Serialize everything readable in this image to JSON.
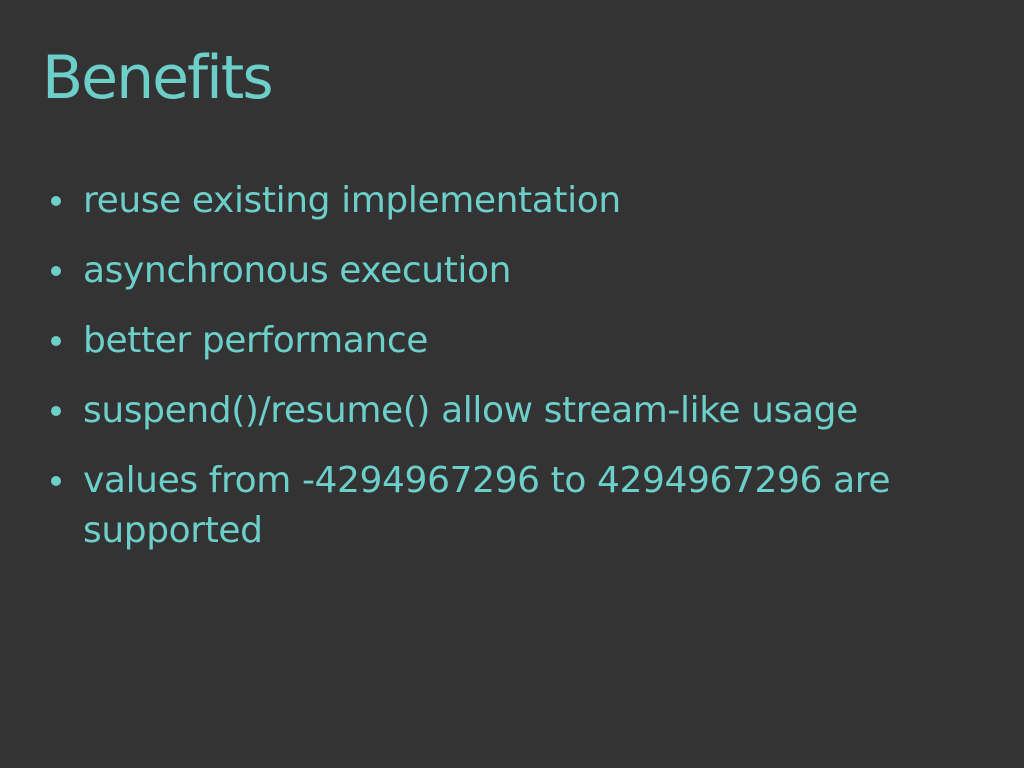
{
  "slide": {
    "title": "Benefits",
    "bullets": [
      "reuse existing implementation",
      "asynchronous execution",
      "better performance",
      "suspend()/resume() allow stream-like usage",
      "values from -4294967296 to 4294967296 are supported"
    ]
  },
  "colors": {
    "background": "#333333",
    "text": "#6dcfca"
  }
}
